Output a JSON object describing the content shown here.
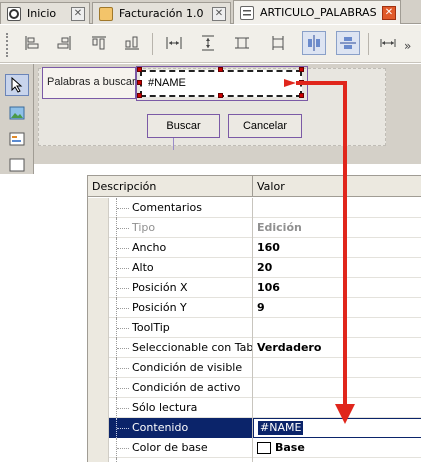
{
  "tabs": [
    {
      "label": "Inicio",
      "icon": "app-logo-icon",
      "active": false
    },
    {
      "label": "Facturación 1.0",
      "icon": "document-icon",
      "active": false
    },
    {
      "label": "ARTICULO_PALABRAS",
      "icon": "form-icon",
      "active": true
    }
  ],
  "toolbar": {
    "buttons": [
      "align-left-icon",
      "align-right-icon",
      "align-top-icon",
      "align-bottom-icon",
      "same-width-icon",
      "same-height-icon",
      "same-size-horizontal-icon",
      "same-size-vertical-icon",
      "center-horizontal-icon",
      "center-vertical-icon",
      "space-horizontal-icon"
    ]
  },
  "palette": {
    "tools": [
      "pointer-icon",
      "image-icon",
      "textbox-icon",
      "panel-icon"
    ]
  },
  "form": {
    "label_text": "Palabras a buscar",
    "field_text": "#NAME",
    "search_button": "Buscar",
    "cancel_button": "Cancelar"
  },
  "grid": {
    "col_description": "Descripción",
    "col_value": "Valor",
    "rows": [
      {
        "name": "Comentarios",
        "value": "",
        "dim": false
      },
      {
        "name": "Tipo",
        "value": "Edición",
        "dim": true
      },
      {
        "name": "Ancho",
        "value": "160",
        "dim": false
      },
      {
        "name": "Alto",
        "value": "20",
        "dim": false
      },
      {
        "name": "Posición X",
        "value": "106",
        "dim": false
      },
      {
        "name": "Posición Y",
        "value": "9",
        "dim": false
      },
      {
        "name": "ToolTip",
        "value": "",
        "dim": false
      },
      {
        "name": "Seleccionable con Tab",
        "value": "Verdadero",
        "dim": false
      },
      {
        "name": "Condición de visible",
        "value": "",
        "dim": false
      },
      {
        "name": "Condición de activo",
        "value": "",
        "dim": false
      },
      {
        "name": "Sólo lectura",
        "value": "",
        "dim": false
      },
      {
        "name": "Contenido",
        "value": "#NAME",
        "dim": false
      },
      {
        "name": "Color de base",
        "value": "Base",
        "dim": false
      }
    ]
  },
  "colors": {
    "selection": "#0b246a",
    "annotation_arrow": "#e0261c",
    "design_border": "#7b5aa6",
    "active_close": "#e05a2a"
  }
}
